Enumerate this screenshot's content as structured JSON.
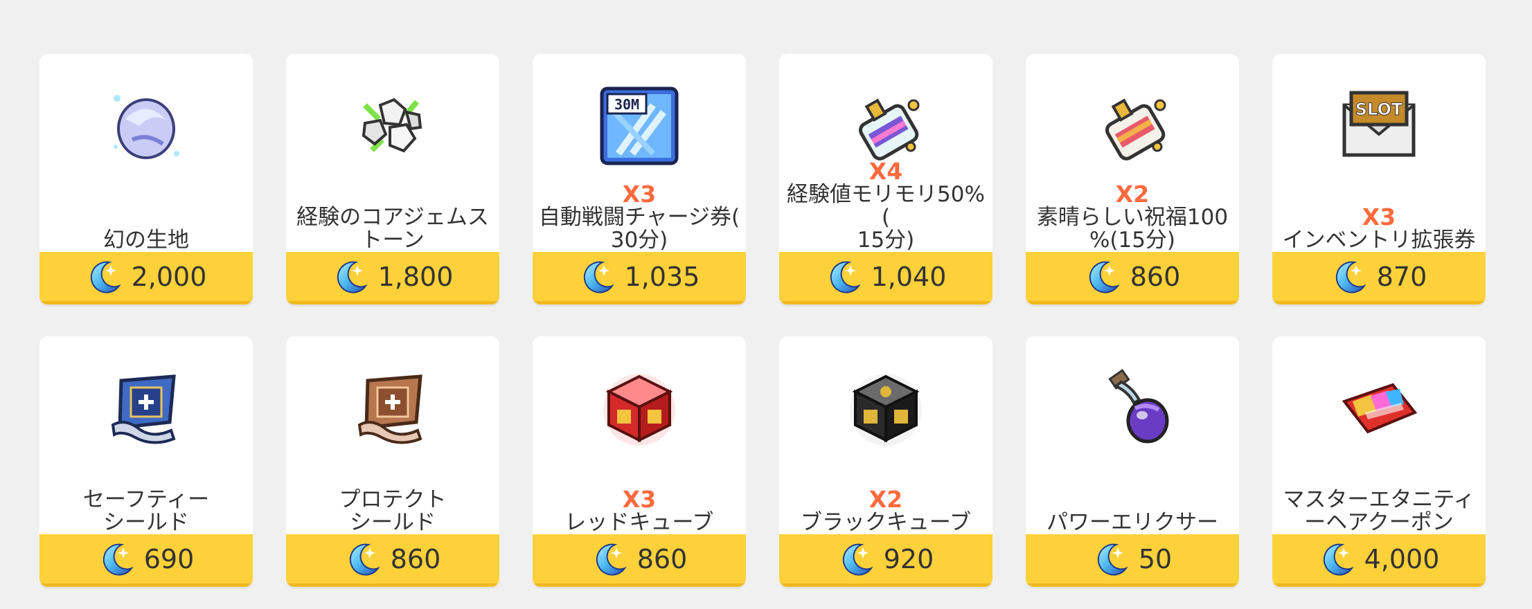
{
  "items": [
    {
      "name": "幻の生地",
      "qty": "",
      "price": "2,000",
      "icon": "fabric-icon"
    },
    {
      "name": "経験のコアジェムス\nトーン",
      "qty": "",
      "price": "1,800",
      "icon": "core-gemstone-icon"
    },
    {
      "name": "自動戦闘チャージ券(\n30分)",
      "qty": "X3",
      "price": "1,035",
      "icon": "auto-battle-ticket-icon",
      "badge": "30M"
    },
    {
      "name": "経験値モリモリ50%(\n15分)",
      "qty": "X4",
      "price": "1,040",
      "icon": "exp-potion-icon"
    },
    {
      "name": "素晴らしい祝福100\n%(15分)",
      "qty": "X2",
      "price": "860",
      "icon": "blessing-potion-icon"
    },
    {
      "name": "インベントリ拡張券",
      "qty": "X3",
      "price": "870",
      "icon": "inventory-slot-ticket-icon",
      "badge": "SLOT"
    },
    {
      "name": "セーフティー\nシールド",
      "qty": "",
      "price": "690",
      "icon": "safety-shield-scroll-icon"
    },
    {
      "name": "プロテクト\nシールド",
      "qty": "",
      "price": "860",
      "icon": "protect-shield-scroll-icon"
    },
    {
      "name": "レッドキューブ",
      "qty": "X3",
      "price": "860",
      "icon": "red-cube-icon"
    },
    {
      "name": "ブラックキューブ",
      "qty": "X2",
      "price": "920",
      "icon": "black-cube-icon"
    },
    {
      "name": "パワーエリクサー",
      "qty": "",
      "price": "50",
      "icon": "power-elixir-icon"
    },
    {
      "name": "マスターエタニティ\nーヘアクーポン",
      "qty": "",
      "price": "4,000",
      "icon": "hair-coupon-icon"
    }
  ],
  "currency_icon": "moon-coin-icon",
  "colors": {
    "background": "#f0f0f0",
    "card": "#ffffff",
    "price_bar": "#fdd13a",
    "quantity": "#ff6a3d"
  }
}
